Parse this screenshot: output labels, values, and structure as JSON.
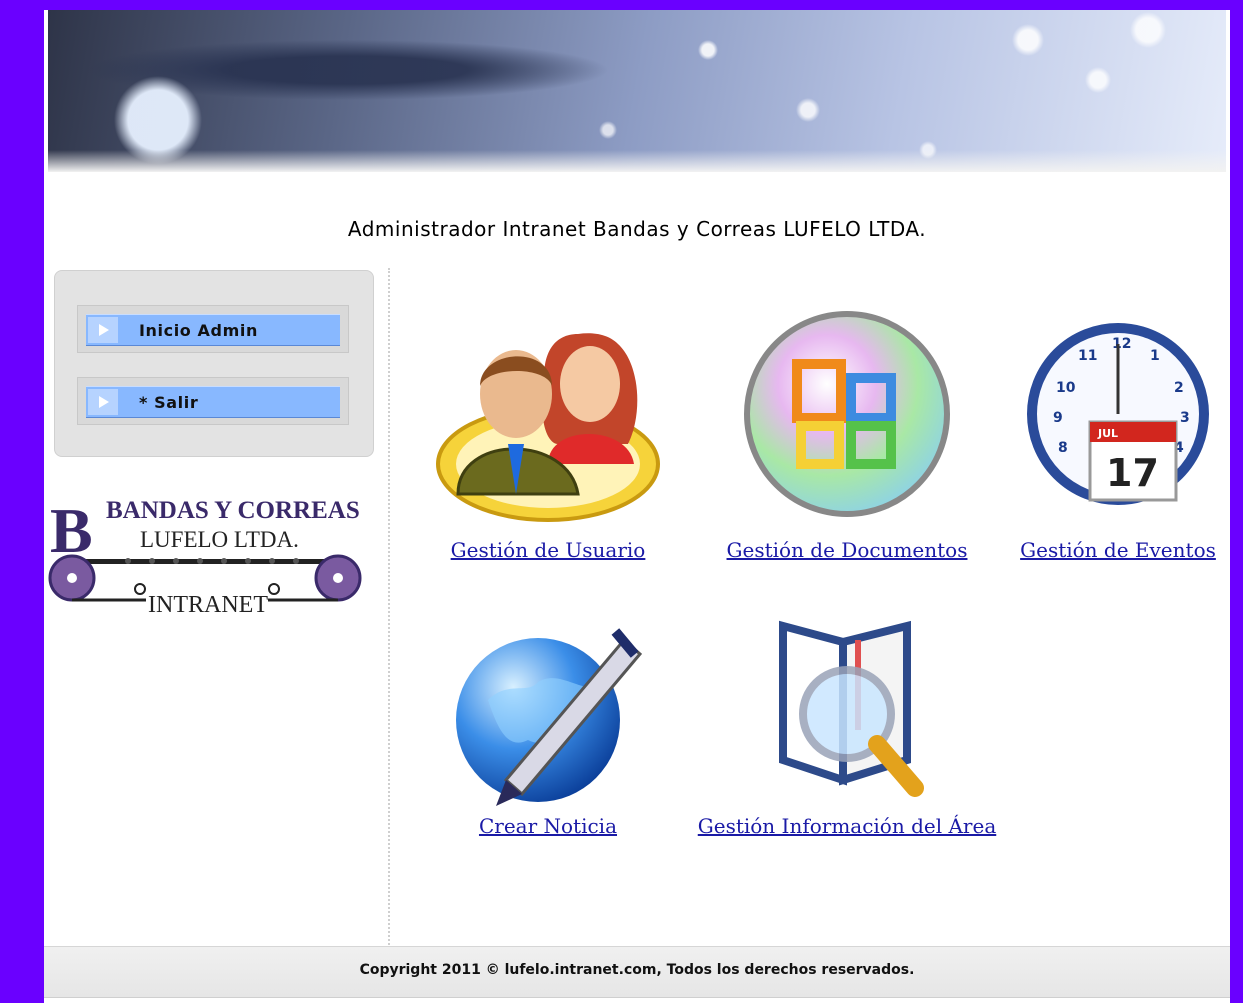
{
  "site": {
    "title": "Administrador Intranet Bandas y Correas LUFELO LTDA."
  },
  "menu": {
    "items": [
      {
        "label": "Inicio Admin"
      },
      {
        "label": "* Salir"
      }
    ]
  },
  "logo": {
    "line1": "BANDAS Y CORREAS",
    "line2": "LUFELO LTDA.",
    "line3": "INTRANET"
  },
  "modules": [
    {
      "label": "Gestión de Usuario",
      "icon": "users-icon"
    },
    {
      "label": "Gestión de Documentos",
      "icon": "office-documents-icon"
    },
    {
      "label": "Gestión de Eventos",
      "icon": "clock-calendar-icon"
    },
    {
      "label": "Crear Noticia",
      "icon": "globe-pen-icon"
    },
    {
      "label": "Gestión Información del Área",
      "icon": "book-magnifier-icon"
    }
  ],
  "calendar_icon": {
    "month": "JUL",
    "day": "17"
  },
  "footer": {
    "text": "Copyright 2011 © lufelo.intranet.com, Todos los derechos reservados."
  },
  "colors": {
    "frame": "#6a00ff",
    "menu_button": "#88b8ff",
    "link": "#1a1aa6"
  }
}
